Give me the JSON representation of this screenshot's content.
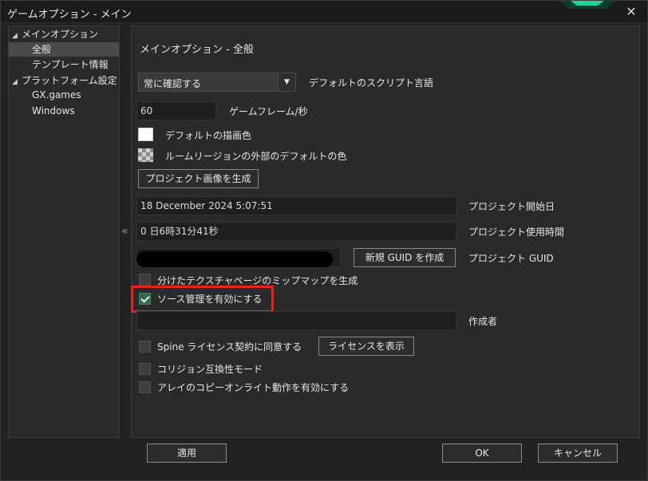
{
  "window": {
    "title": "ゲームオプション - メイン",
    "accent_color": "#1fd39a",
    "highlight_color": "#e8221e"
  },
  "sidebar": {
    "items": [
      {
        "label": "メインオプション",
        "expanded": true
      },
      {
        "label": "全般",
        "selected": true
      },
      {
        "label": "テンプレート情報"
      },
      {
        "label": "プラットフォーム設定",
        "expanded": true
      },
      {
        "label": "GX.games"
      },
      {
        "label": "Windows"
      }
    ],
    "expand_glyph": "◢",
    "collapse_glyph": "«"
  },
  "main": {
    "section_title": "メインオプション - 全般",
    "script_language": {
      "value": "常に確認する",
      "label": "デフォルトのスクリプト言語"
    },
    "fps": {
      "value": "60",
      "label": "ゲームフレーム/秒"
    },
    "draw_color_label": "デフォルトの描画色",
    "room_color_label": "ルームリージョンの外部のデフォルトの色",
    "generate_image_button": "プロジェクト画像を生成",
    "start_date": {
      "value": "18 December 2024 5:07:51",
      "label": "プロジェクト開始日"
    },
    "usage_time": {
      "value": "0 日6時31分41秒",
      "label": "プロジェクト使用時間"
    },
    "guid": {
      "button": "新規 GUID を作成",
      "label": "プロジェクト GUID"
    },
    "mipmaps": {
      "label": "分けたテクスチャページのミップマップを生成",
      "checked": false
    },
    "source_control": {
      "label": "ソース管理を有効にする",
      "checked": true
    },
    "author": {
      "value": "",
      "label": "作成者"
    },
    "spine": {
      "label": "Spine ライセンス契約に同意する",
      "checked": false,
      "button": "ライセンスを表示"
    },
    "collision_compat": {
      "label": "コリジョン互換性モード",
      "checked": false
    },
    "array_copy_on_write": {
      "label": "アレイのコピーオンライト動作を有効にする",
      "checked": false
    }
  },
  "footer": {
    "apply": "適用",
    "ok": "OK",
    "cancel": "キャンセル"
  }
}
